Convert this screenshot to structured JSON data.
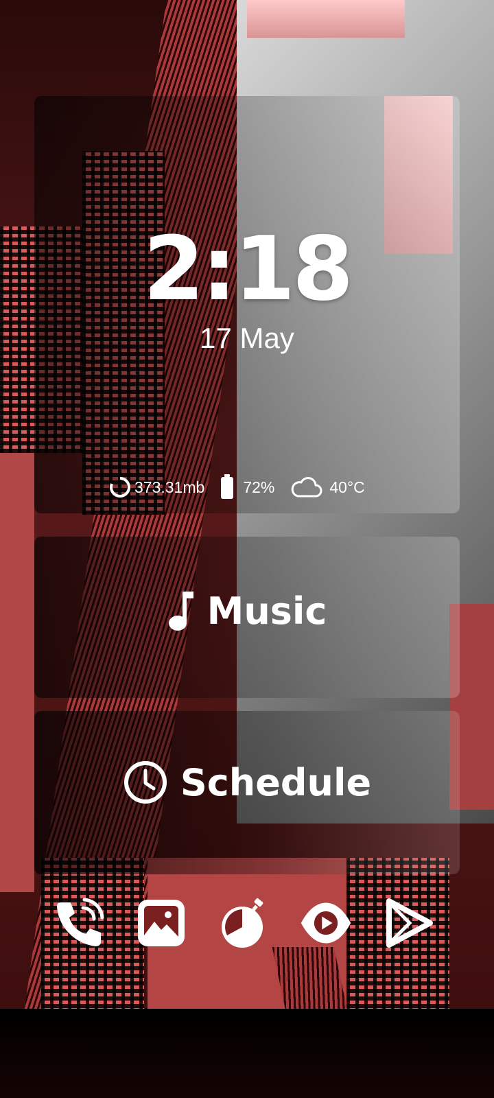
{
  "lockscreen": {
    "time": "2:18",
    "date": "17 May"
  },
  "stats": {
    "memory": {
      "icon": "memory-ring-icon",
      "value": "373.31mb"
    },
    "battery": {
      "icon": "battery-icon",
      "value": "72%"
    },
    "weather": {
      "icon": "cloud-icon",
      "value": "40°C"
    }
  },
  "widgets": {
    "music": {
      "icon": "music-note-icon",
      "label": "Music"
    },
    "schedule": {
      "icon": "clock-icon",
      "label": "Schedule"
    }
  },
  "dock": [
    {
      "name": "phone-app",
      "icon": "phone-call-icon"
    },
    {
      "name": "gallery-app",
      "icon": "image-icon"
    },
    {
      "name": "timer-app",
      "icon": "stopwatch-icon"
    },
    {
      "name": "video-app",
      "icon": "play-eye-icon"
    },
    {
      "name": "play-store-app",
      "icon": "play-triangle-icon"
    }
  ],
  "colors": {
    "accent_red": "#d85a5a",
    "text": "#ffffff"
  }
}
